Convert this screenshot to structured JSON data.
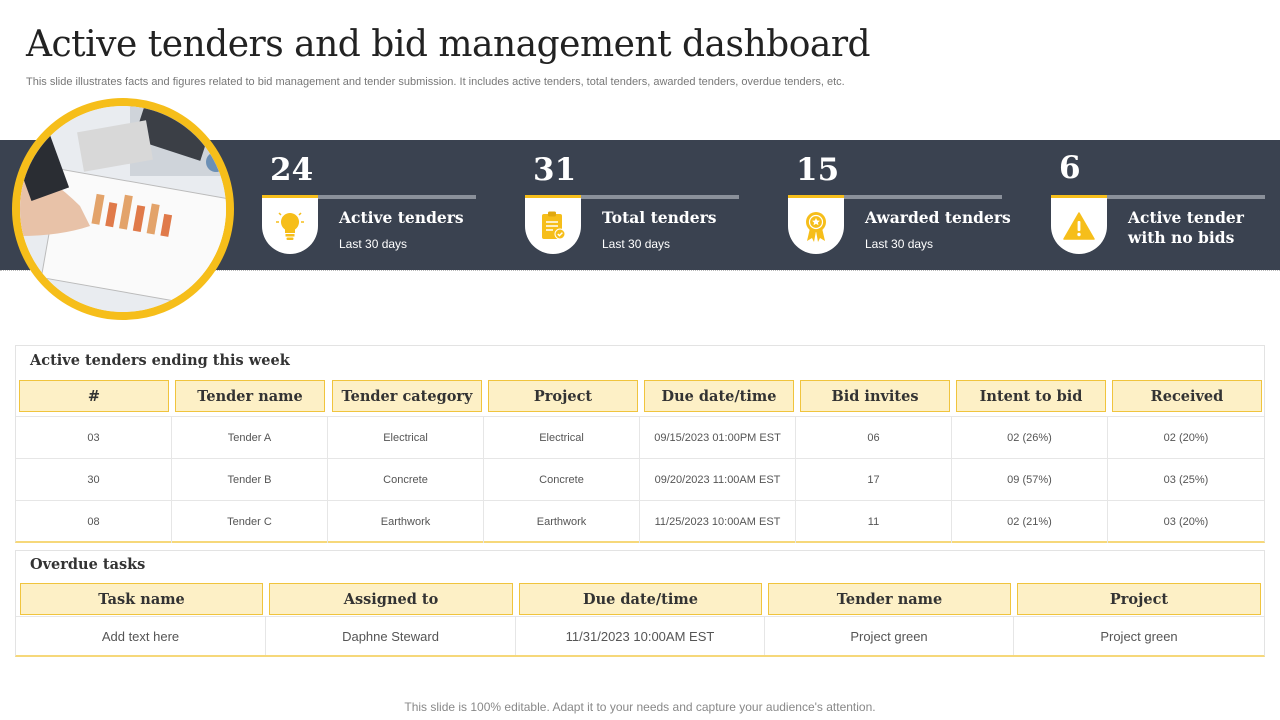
{
  "header": {
    "title": "Active tenders and bid management dashboard",
    "subtitle": "This slide illustrates facts and figures related to bid management and tender submission. It includes active tenders, total tenders, awarded tenders, overdue tenders, etc."
  },
  "colors": {
    "accent": "#f6be1a",
    "band": "#3a4250",
    "header_fill": "#fdf0c6"
  },
  "stats": [
    {
      "value": "24",
      "label_line1": "Active tenders",
      "label_line2": "",
      "sub": "Last 30 days",
      "icon": "lightbulb-icon"
    },
    {
      "value": "31",
      "label_line1": "Total tenders",
      "label_line2": "",
      "sub": "Last 30 days",
      "icon": "clipboard-check-icon"
    },
    {
      "value": "15",
      "label_line1": "Awarded tenders",
      "label_line2": "",
      "sub": "Last 30 days",
      "icon": "award-medal-icon"
    },
    {
      "value": "6",
      "label_line1": "Active tender",
      "label_line2": "with no bids",
      "sub": "",
      "icon": "warning-icon"
    }
  ],
  "active_table": {
    "title": "Active tenders ending this week",
    "headers": [
      "#",
      "Tender name",
      "Tender category",
      "Project",
      "Due date/time",
      "Bid invites",
      "Intent to bid",
      "Received"
    ],
    "rows": [
      [
        "03",
        "Tender A",
        "Electrical",
        "Electrical",
        "09/15/2023 01:00PM  EST",
        "06",
        "02 (26%)",
        "02 (20%)"
      ],
      [
        "30",
        "Tender B",
        "Concrete",
        "Concrete",
        "09/20/2023 11:00AM EST",
        "17",
        "09 (57%)",
        "03 (25%)"
      ],
      [
        "08",
        "Tender C",
        "Earthwork",
        "Earthwork",
        "11/25/2023 10:00AM EST",
        "11",
        "02 (21%)",
        "03 (20%)"
      ]
    ]
  },
  "overdue_table": {
    "title": "Overdue tasks",
    "headers": [
      "Task name",
      "Assigned  to",
      "Due date/time",
      "Tender name",
      "Project"
    ],
    "rows": [
      [
        "Add text here",
        "Daphne  Steward",
        "11/31/2023  10:00AM EST",
        "Project green",
        "Project green"
      ]
    ]
  },
  "footer": "This slide is 100% editable. Adapt it to your needs and capture your audience's attention."
}
